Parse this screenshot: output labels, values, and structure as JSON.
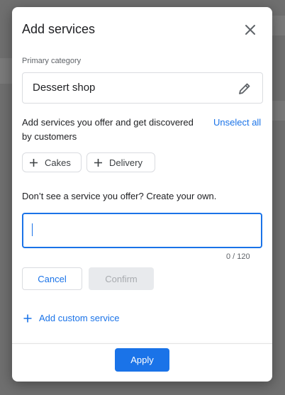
{
  "dialog": {
    "title": "Add services",
    "close_icon": "close-icon"
  },
  "primary_category": {
    "label": "Primary category",
    "value": "Dessert shop",
    "edit_icon": "pencil-icon"
  },
  "services": {
    "description": "Add services you offer and get discovered by customers",
    "unselect_all": "Unselect all",
    "chips": [
      {
        "label": "Cakes",
        "icon": "plus-icon"
      },
      {
        "label": "Delivery",
        "icon": "plus-icon"
      }
    ]
  },
  "custom": {
    "prompt": "Don’t see a service you offer? Create your own.",
    "input_value": "",
    "counter": "0 / 120",
    "cancel_label": "Cancel",
    "confirm_label": "Confirm",
    "add_custom_label": "Add custom service"
  },
  "footer": {
    "apply_label": "Apply"
  },
  "colors": {
    "accent": "#1a73e8",
    "border": "#dadce0",
    "disabled_bg": "#e8eaed"
  }
}
